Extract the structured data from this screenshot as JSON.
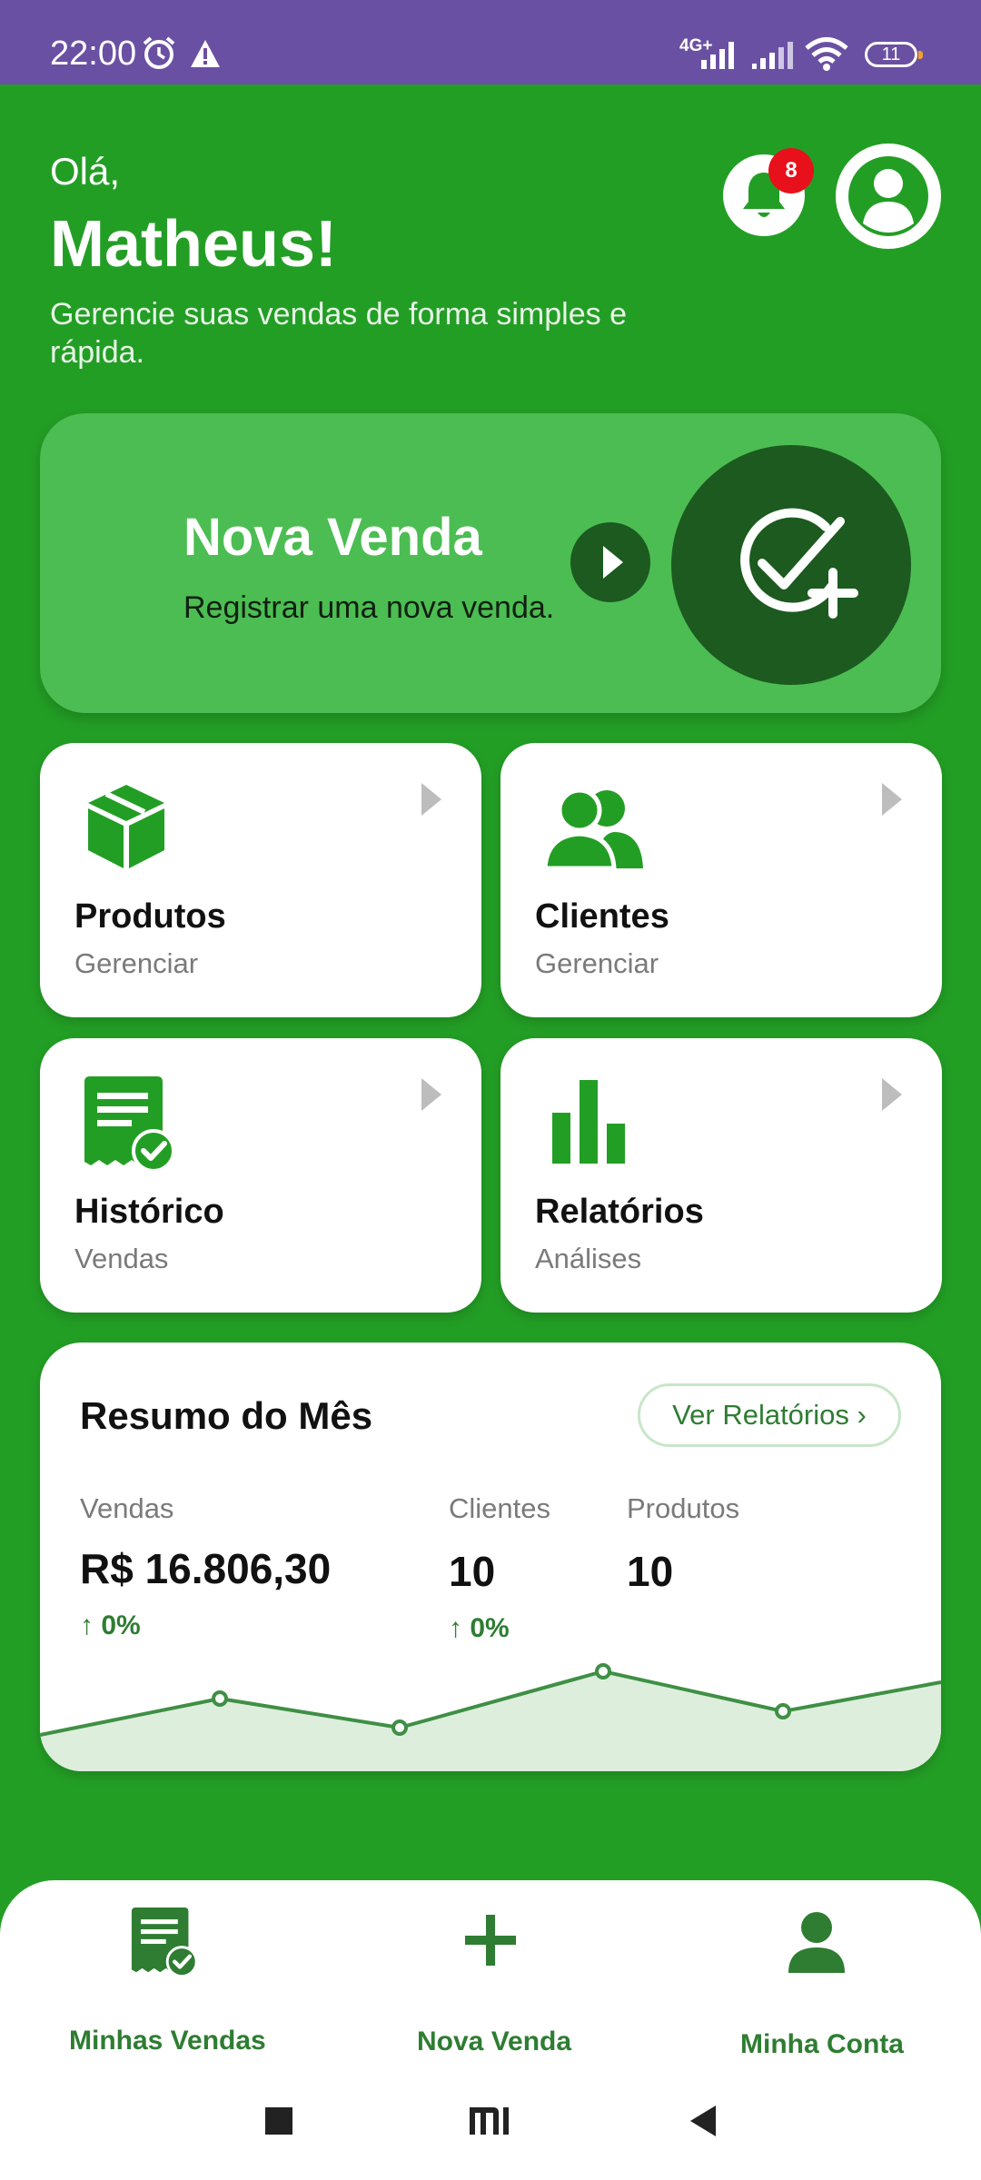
{
  "status_bar": {
    "time": "22:00",
    "network_label": "4G+",
    "battery": "11",
    "icons": [
      "alarm-icon",
      "warning-icon",
      "signal-icon",
      "signal-icon",
      "wifi-icon",
      "battery-icon"
    ]
  },
  "header": {
    "greeting": "Olá,",
    "name": "Matheus!",
    "subtitle": "Gerencie suas vendas de forma simples e rápida.",
    "notification_count": "8"
  },
  "nova_venda": {
    "title": "Nova Venda",
    "subtitle": "Registrar uma nova venda."
  },
  "tiles": [
    {
      "title": "Produtos",
      "subtitle": "Gerenciar",
      "icon": "box-icon"
    },
    {
      "title": "Clientes",
      "subtitle": "Gerenciar",
      "icon": "users-icon"
    },
    {
      "title": "Histórico",
      "subtitle": "Vendas",
      "icon": "receipt-check-icon"
    },
    {
      "title": "Relatórios",
      "subtitle": "Análises",
      "icon": "bar-chart-icon"
    }
  ],
  "summary": {
    "title": "Resumo do Mês",
    "button": "Ver Relatórios ›",
    "stats": [
      {
        "label": "Vendas",
        "value": "R$ 16.806,30",
        "trend": "↑ 0%"
      },
      {
        "label": "Clientes",
        "value": "10",
        "trend": "↑ 0%"
      },
      {
        "label": "Produtos",
        "value": "10"
      }
    ]
  },
  "bottom_nav": {
    "items": [
      {
        "label": "Minhas Vendas",
        "icon": "receipt-check-icon"
      },
      {
        "label": "Nova Venda",
        "icon": "plus-icon"
      },
      {
        "label": "Minha Conta",
        "icon": "person-icon"
      }
    ]
  },
  "colors": {
    "background": "#239e25",
    "status_bar": "#6a50a3",
    "card_highlight": "#4cbd52",
    "dark_green": "#1c5a20",
    "accent_green": "#2e7d32",
    "badge_red": "#e8101a"
  }
}
